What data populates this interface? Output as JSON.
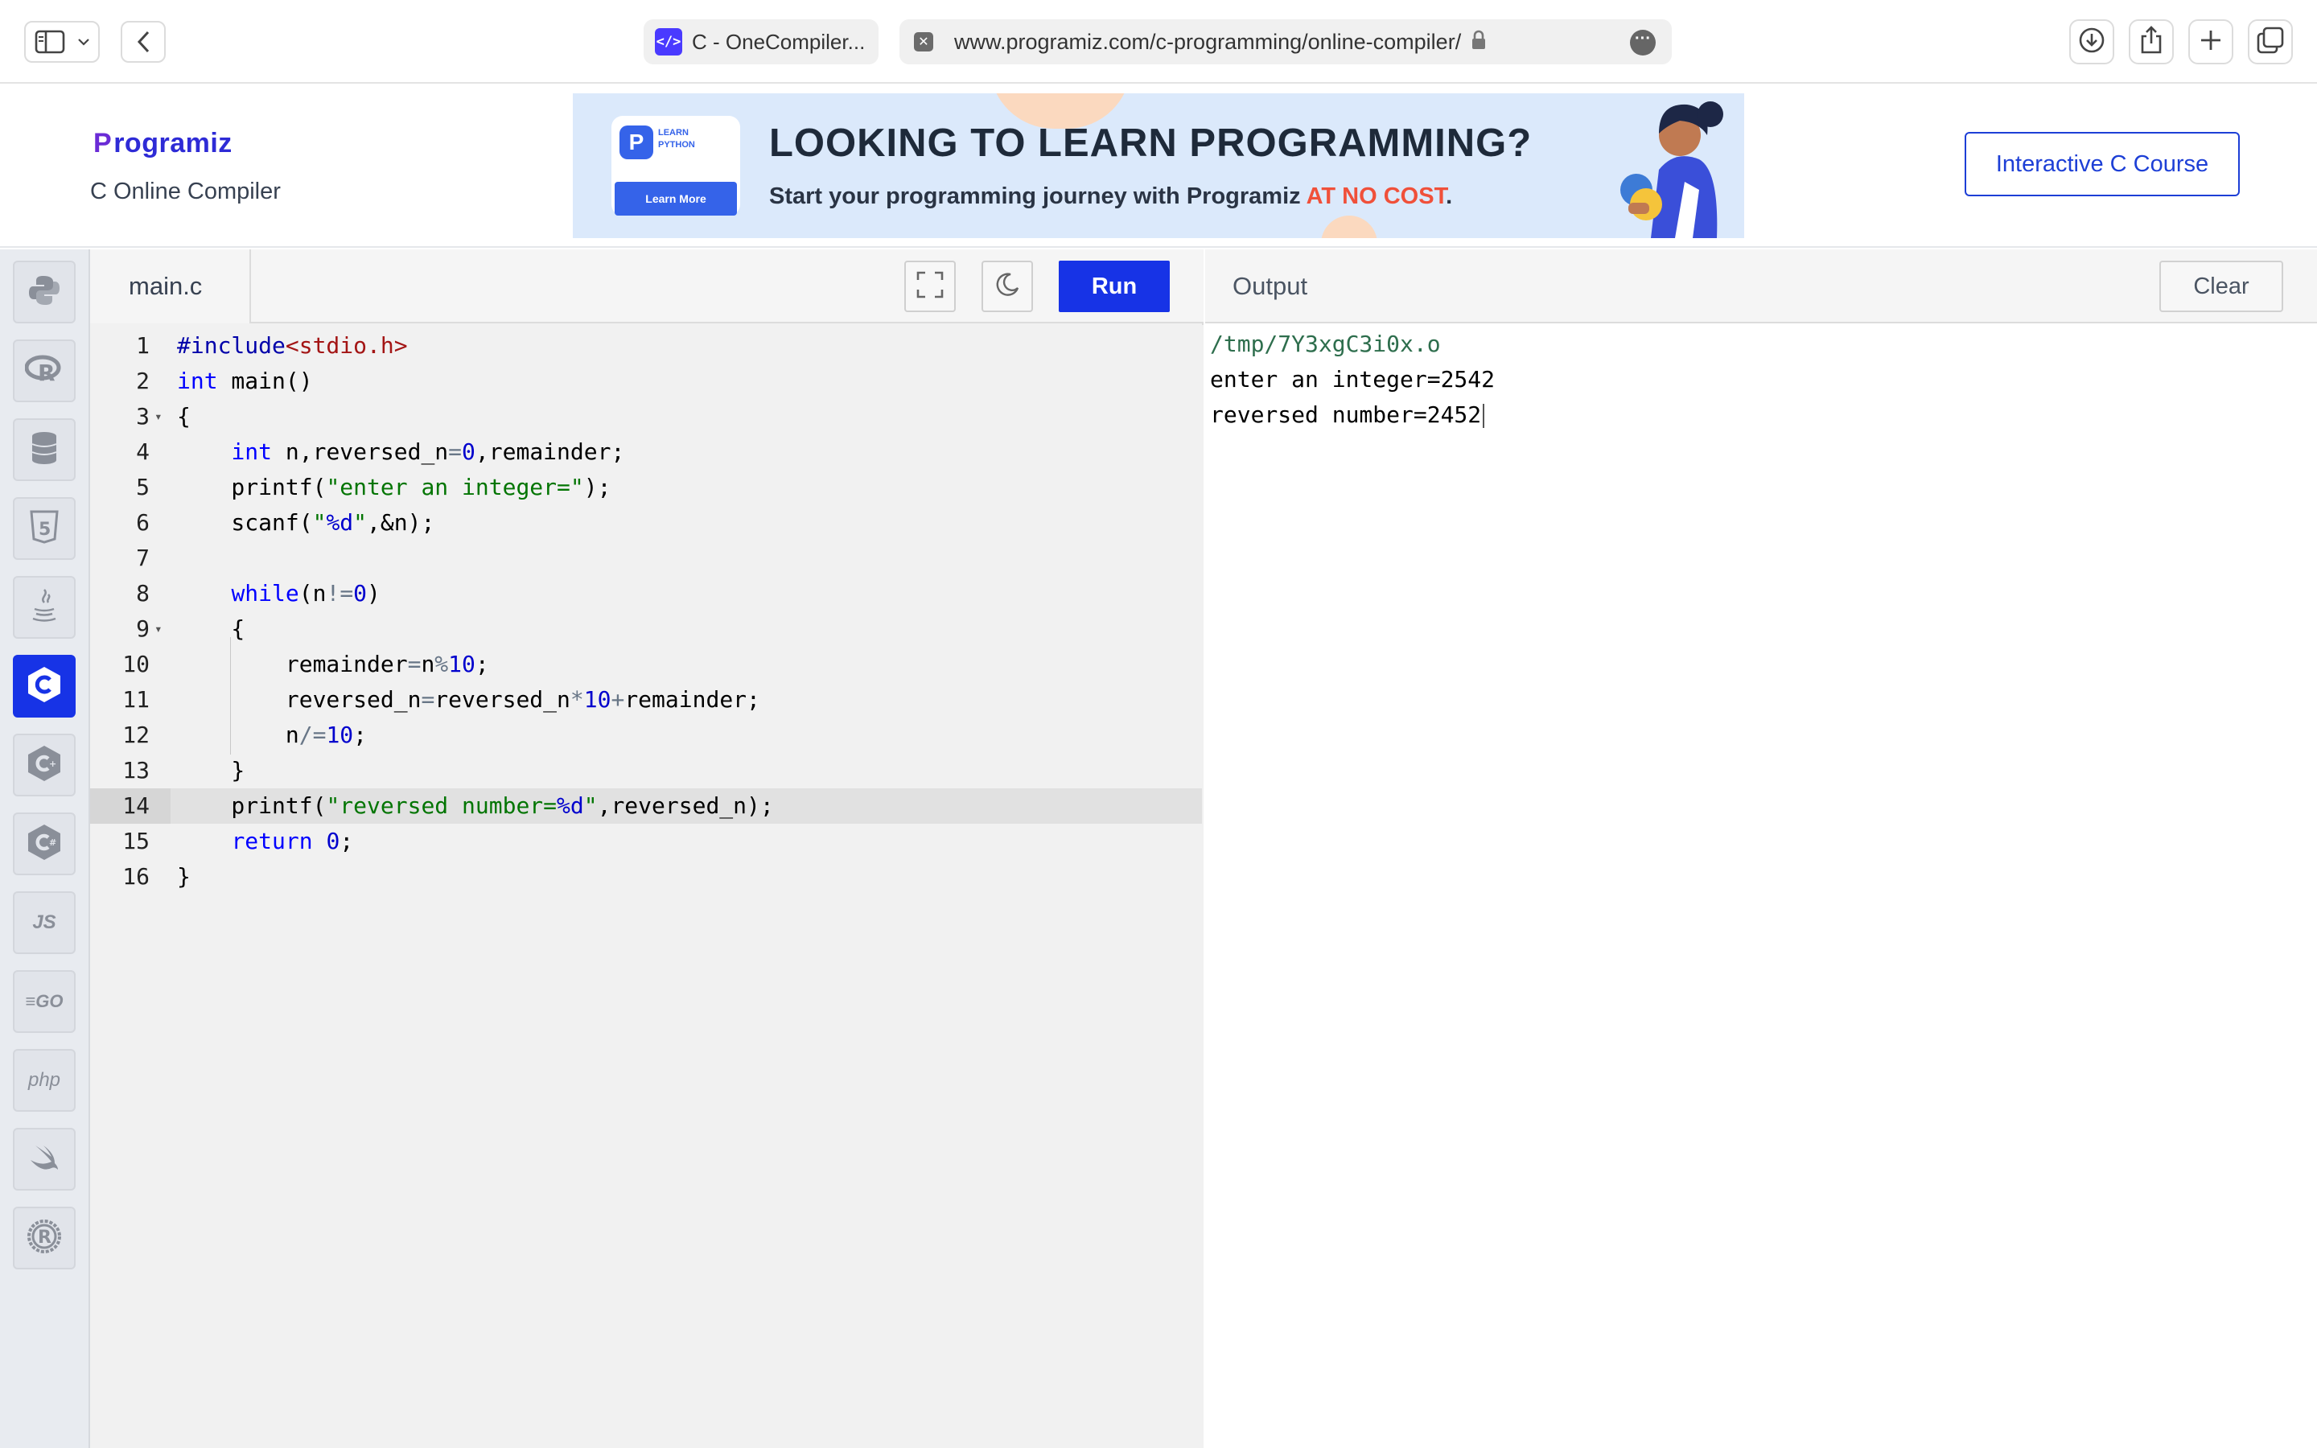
{
  "browser": {
    "tab_title": "C - OneCompiler...",
    "tab_favicon": "</>",
    "url": "www.programiz.com/c-programming/online-compiler/",
    "icons": [
      "sidebar-icon",
      "chevron-down-icon",
      "back-icon",
      "lock-icon",
      "more-icon",
      "download-icon",
      "share-icon",
      "new-tab-icon",
      "tabs-overview-icon"
    ]
  },
  "header": {
    "logo_initial": "P",
    "logo_rest": "rogramiz",
    "subtitle": "C Online Compiler",
    "course_button": "Interactive C Course"
  },
  "ad": {
    "card_label_line1": "LEARN",
    "card_label_line2": "PYTHON",
    "card_button": "Learn More",
    "headline": "LOOKING TO LEARN PROGRAMMING?",
    "subline": "Start your programming journey with Programiz ",
    "subline_accent": "AT NO COST",
    "subline_end": "."
  },
  "languages": [
    {
      "name": "python",
      "glyph": "py"
    },
    {
      "name": "r",
      "glyph": "R"
    },
    {
      "name": "sql",
      "glyph": "db"
    },
    {
      "name": "html",
      "glyph": "5"
    },
    {
      "name": "java",
      "glyph": "java"
    },
    {
      "name": "c",
      "glyph": "C",
      "active": true
    },
    {
      "name": "cpp",
      "glyph": "C+"
    },
    {
      "name": "csharp",
      "glyph": "C#"
    },
    {
      "name": "javascript",
      "glyph": "JS"
    },
    {
      "name": "go",
      "glyph": "GO"
    },
    {
      "name": "php",
      "glyph": "php"
    },
    {
      "name": "swift",
      "glyph": "swift"
    },
    {
      "name": "rust",
      "glyph": "R"
    }
  ],
  "editor": {
    "file_name": "main.c",
    "run_label": "Run",
    "current_line": 14,
    "lines": [
      {
        "n": "1",
        "code": "#include<stdio.h>"
      },
      {
        "n": "2",
        "code": "int main()"
      },
      {
        "n": "3",
        "code": "{",
        "fold": true
      },
      {
        "n": "4",
        "code": "    int n,reversed_n=0,remainder;"
      },
      {
        "n": "5",
        "code": "    printf(\"enter an integer=\");"
      },
      {
        "n": "6",
        "code": "    scanf(\"%d\",&n);"
      },
      {
        "n": "7",
        "code": ""
      },
      {
        "n": "8",
        "code": "    while(n!=0)"
      },
      {
        "n": "9",
        "code": "    {",
        "fold": true
      },
      {
        "n": "10",
        "code": "        remainder=n%10;"
      },
      {
        "n": "11",
        "code": "        reversed_n=reversed_n*10+remainder;"
      },
      {
        "n": "12",
        "code": "        n/=10;"
      },
      {
        "n": "13",
        "code": "    }"
      },
      {
        "n": "14",
        "code": "    printf(\"reversed number=%d\",reversed_n);"
      },
      {
        "n": "15",
        "code": "    return 0;"
      },
      {
        "n": "16",
        "code": "}"
      }
    ]
  },
  "output": {
    "title": "Output",
    "clear_label": "Clear",
    "lines": [
      "/tmp/7Y3xgC3i0x.o",
      "enter an integer=2542",
      "reversed number=2452"
    ]
  },
  "colors": {
    "accent": "#1733e6",
    "keyword": "#0000ff",
    "string": "#037503",
    "number": "#0000cd",
    "ad_accent": "#f0503a"
  }
}
